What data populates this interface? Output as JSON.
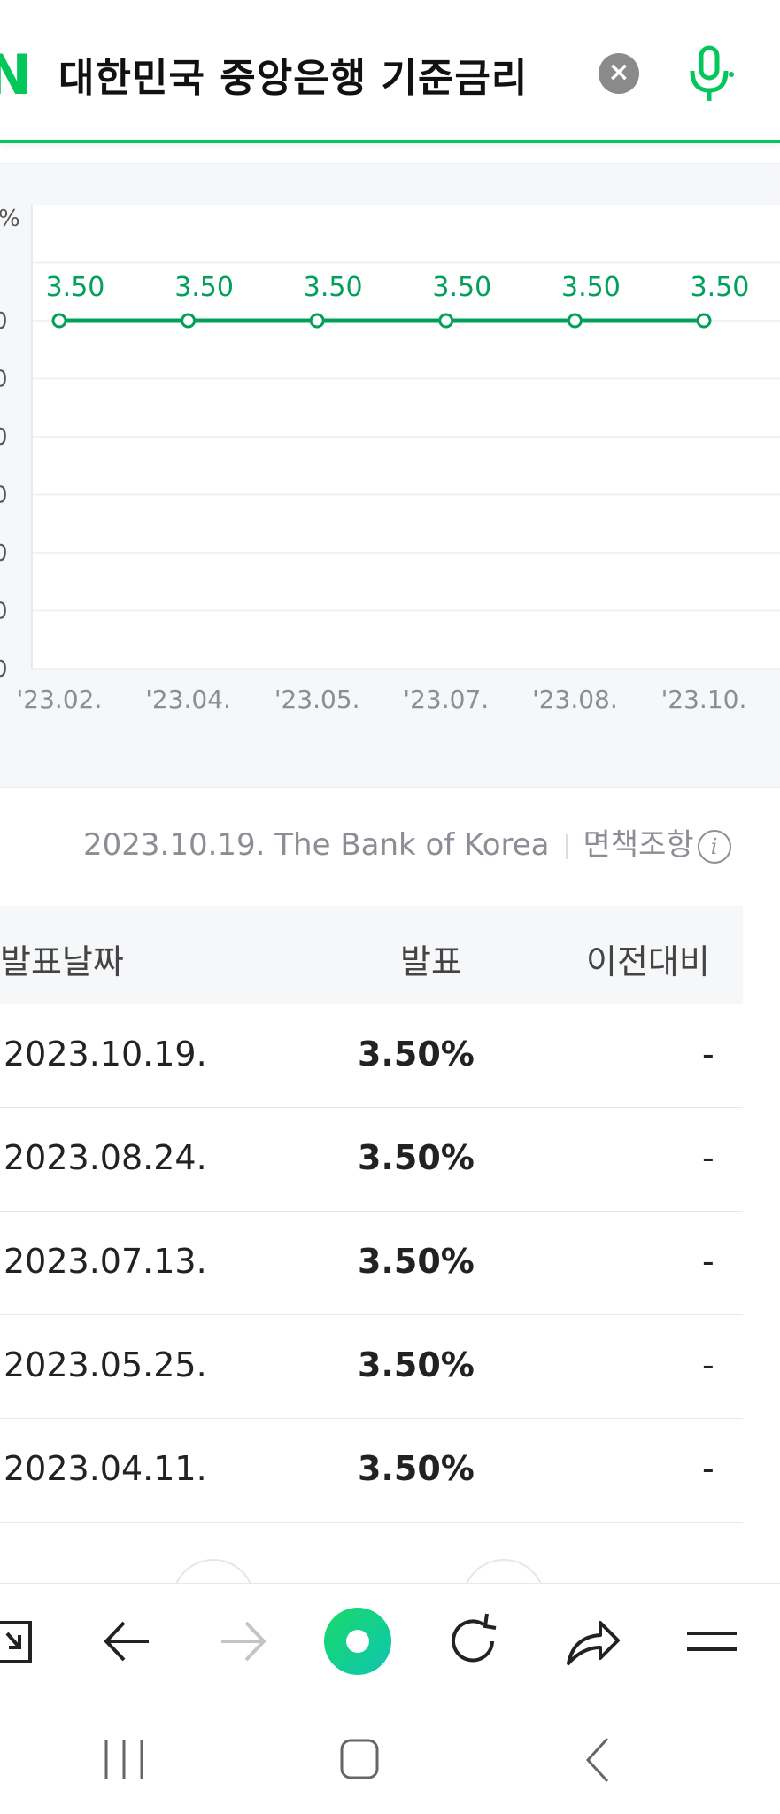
{
  "search": {
    "query": "대한민국 중앙은행 기준금리",
    "logo_letter": "N"
  },
  "chart_data": {
    "type": "line",
    "title": "",
    "x": [
      "'23.02.",
      "'23.04.",
      "'23.05.",
      "'23.07.",
      "'23.08.",
      "'23.10."
    ],
    "series": [
      {
        "values": [
          3.5,
          3.5,
          3.5,
          3.5,
          3.5,
          3.5
        ]
      }
    ],
    "value_labels": [
      "3.50",
      "3.50",
      "3.50",
      "3.50",
      "3.50",
      "3.50"
    ],
    "ylabel": "%",
    "y_tick_labels": [
      "0",
      "0",
      "0",
      "0",
      "0",
      "0",
      "0"
    ],
    "grid": true,
    "line_color": "#03a05c"
  },
  "source": {
    "text": "2023.10.19. The Bank of Korea",
    "disclaimer": "면책조항",
    "info_icon": "i"
  },
  "table": {
    "headers": {
      "date": "발표날짜",
      "rate": "발표",
      "change": "이전대비"
    },
    "rows": [
      {
        "date": "2023.10.19.",
        "rate": "3.50%",
        "change": "-"
      },
      {
        "date": "2023.08.24.",
        "rate": "3.50%",
        "change": "-"
      },
      {
        "date": "2023.07.13.",
        "rate": "3.50%",
        "change": "-"
      },
      {
        "date": "2023.05.25.",
        "rate": "3.50%",
        "change": "-"
      },
      {
        "date": "2023.04.11.",
        "rate": "3.50%",
        "change": "-"
      }
    ]
  },
  "toolbar": {
    "icons": [
      "new-tab-icon",
      "back-arrow-icon",
      "forward-arrow-icon",
      "home-dot-icon",
      "refresh-icon",
      "share-icon",
      "menu-icon"
    ]
  },
  "system_nav": {
    "icons": [
      "recent-apps-icon",
      "home-icon",
      "back-icon"
    ]
  },
  "colors": {
    "brand": "#03c75a",
    "accent_line": "#03a05c"
  }
}
